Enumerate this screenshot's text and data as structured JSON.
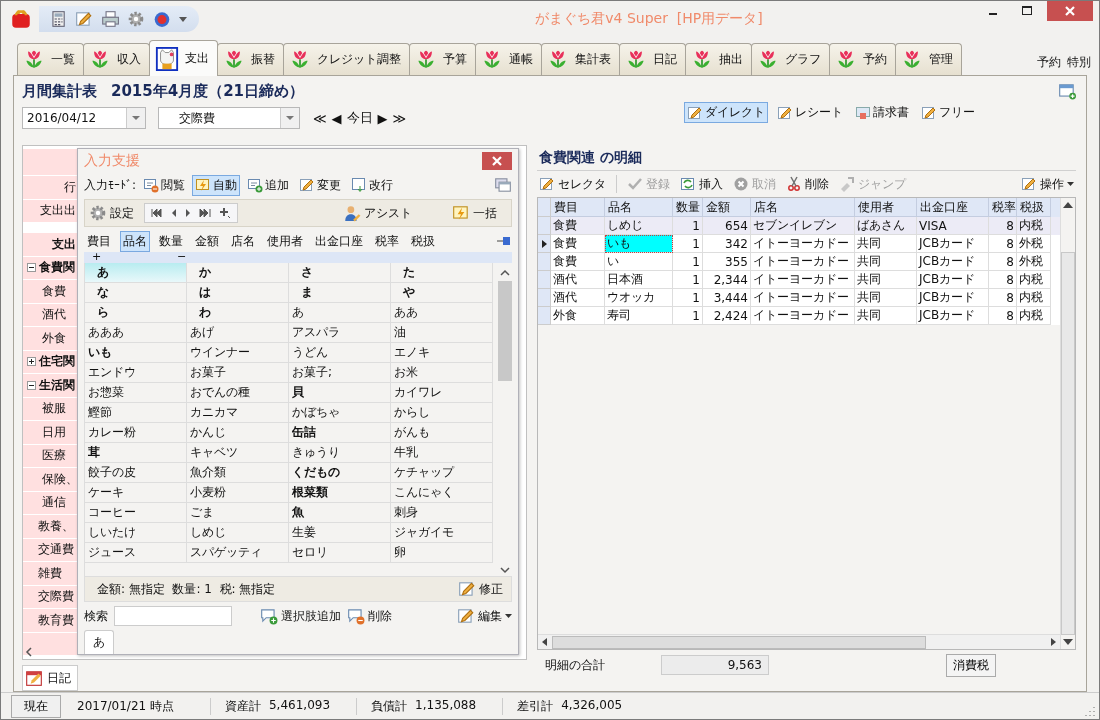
{
  "window": {
    "title": "がまぐち君v4 Super  [HP用データ]"
  },
  "tabs": [
    {
      "label": "一覧",
      "selected": false
    },
    {
      "label": "収入",
      "selected": false
    },
    {
      "label": "支出",
      "selected": true
    },
    {
      "label": "振替",
      "selected": false
    },
    {
      "label": "クレジット調整",
      "selected": false
    },
    {
      "label": "予算",
      "selected": false
    },
    {
      "label": "通帳",
      "selected": false
    },
    {
      "label": "集計表",
      "selected": false
    },
    {
      "label": "日記",
      "selected": false
    },
    {
      "label": "抽出",
      "selected": false
    },
    {
      "label": "グラフ",
      "selected": false
    },
    {
      "label": "予約",
      "selected": false
    },
    {
      "label": "管理",
      "selected": false
    }
  ],
  "tab_links": [
    "予約",
    "特別"
  ],
  "header": {
    "title": "月間集計表",
    "period": "2015年4月度（21日締め）",
    "date": "2016/04/12",
    "category": "交際費",
    "nav": [
      "≪",
      "◀",
      "今日",
      "▶",
      "≫"
    ]
  },
  "views": [
    {
      "label": "ダイレクト",
      "selected": true
    },
    {
      "label": "レシート",
      "selected": false
    },
    {
      "label": "請求書",
      "selected": false
    },
    {
      "label": "フリー",
      "selected": false
    }
  ],
  "sheet": {
    "top_rows": [
      "行",
      "支出出"
    ],
    "tree_header": "支出",
    "tree": [
      {
        "label": "食費関",
        "expanded": true,
        "children": [
          {
            "label": "食費"
          },
          {
            "label": "酒代"
          },
          {
            "label": "外食"
          }
        ]
      },
      {
        "label": "住宅関",
        "expanded": false
      },
      {
        "label": "生活関",
        "expanded": true,
        "children": [
          {
            "label": "被服"
          },
          {
            "label": "日用"
          },
          {
            "label": "医療"
          },
          {
            "label": "保険、"
          },
          {
            "label": "通信"
          }
        ]
      },
      {
        "label": "教養、"
      },
      {
        "label": "交通費"
      },
      {
        "label": "雑費"
      },
      {
        "label": "交際費"
      },
      {
        "label": "教育費"
      }
    ]
  },
  "assist": {
    "title": "入力支援",
    "mode_label": "入力ﾓｰﾄﾞ:",
    "modes": [
      {
        "label": "閲覧",
        "selected": false
      },
      {
        "label": "自動",
        "selected": true
      },
      {
        "label": "追加",
        "selected": false
      },
      {
        "label": "変更",
        "selected": false
      },
      {
        "label": "改行",
        "selected": false
      }
    ],
    "settings": "設定",
    "assist_button": "アシスト",
    "bulk_button": "一括",
    "fields": [
      {
        "label": "費目",
        "selected": false
      },
      {
        "label": "品名",
        "selected": true
      },
      {
        "label": "数量",
        "selected": false
      },
      {
        "label": "金額",
        "selected": false
      },
      {
        "label": "店名",
        "selected": false
      },
      {
        "label": "使用者",
        "selected": false
      },
      {
        "label": "出金口座",
        "selected": false
      },
      {
        "label": "税率",
        "selected": false
      },
      {
        "label": "税扱",
        "selected": false
      }
    ],
    "expand": "+",
    "collapse": "−",
    "grid": [
      [
        {
          "text": "あ",
          "kind": "kana",
          "selected": true
        },
        {
          "text": "か",
          "kind": "kana",
          "selected": false
        },
        {
          "text": "さ",
          "kind": "kana",
          "selected": false
        },
        {
          "text": "た",
          "kind": "kana",
          "selected": false
        }
      ],
      [
        {
          "text": "な",
          "kind": "kana",
          "selected": false
        },
        {
          "text": "は",
          "kind": "kana",
          "selected": false
        },
        {
          "text": "ま",
          "kind": "kana",
          "selected": false
        },
        {
          "text": "や",
          "kind": "kana",
          "selected": false
        }
      ],
      [
        {
          "text": "ら",
          "kind": "kana",
          "selected": false
        },
        {
          "text": "わ",
          "kind": "kana",
          "selected": false
        },
        {
          "text": "あ",
          "kind": "item",
          "selected": false
        },
        {
          "text": "ああ",
          "kind": "item",
          "selected": false
        }
      ],
      [
        {
          "text": "あああ",
          "kind": "item",
          "selected": false
        },
        {
          "text": "あげ",
          "kind": "item",
          "selected": false
        },
        {
          "text": "アスパラ",
          "kind": "item",
          "selected": false
        },
        {
          "text": "油",
          "kind": "item",
          "selected": false
        }
      ],
      [
        {
          "text": "いも",
          "kind": "group",
          "selected": false
        },
        {
          "text": "ウインナー",
          "kind": "item",
          "selected": false
        },
        {
          "text": "うどん",
          "kind": "item",
          "selected": false
        },
        {
          "text": "エノキ",
          "kind": "item",
          "selected": false
        }
      ],
      [
        {
          "text": "エンドウ",
          "kind": "item",
          "selected": false
        },
        {
          "text": "お菓子",
          "kind": "item",
          "selected": false
        },
        {
          "text": "お菓子;",
          "kind": "item",
          "selected": false
        },
        {
          "text": "お米",
          "kind": "item",
          "selected": false
        }
      ],
      [
        {
          "text": "お惣菜",
          "kind": "item",
          "selected": false
        },
        {
          "text": "おでんの種",
          "kind": "item",
          "selected": false
        },
        {
          "text": "貝",
          "kind": "group",
          "selected": false
        },
        {
          "text": "カイワレ",
          "kind": "item",
          "selected": false
        }
      ],
      [
        {
          "text": "鰹節",
          "kind": "item",
          "selected": false
        },
        {
          "text": "カニカマ",
          "kind": "item",
          "selected": false
        },
        {
          "text": "かぼちゃ",
          "kind": "item",
          "selected": false
        },
        {
          "text": "からし",
          "kind": "item",
          "selected": false
        }
      ],
      [
        {
          "text": "カレー粉",
          "kind": "item",
          "selected": false
        },
        {
          "text": "かんじ",
          "kind": "item",
          "selected": false
        },
        {
          "text": "缶詰",
          "kind": "group",
          "selected": false
        },
        {
          "text": "がんも",
          "kind": "item",
          "selected": false
        }
      ],
      [
        {
          "text": "茸",
          "kind": "group",
          "selected": false
        },
        {
          "text": "キャベツ",
          "kind": "item",
          "selected": false
        },
        {
          "text": "きゅうり",
          "kind": "item",
          "selected": false
        },
        {
          "text": "牛乳",
          "kind": "item",
          "selected": false
        }
      ],
      [
        {
          "text": "餃子の皮",
          "kind": "item",
          "selected": false
        },
        {
          "text": "魚介類",
          "kind": "item",
          "selected": false
        },
        {
          "text": "くだもの",
          "kind": "group",
          "selected": false
        },
        {
          "text": "ケチャップ",
          "kind": "item",
          "selected": false
        }
      ],
      [
        {
          "text": "ケーキ",
          "kind": "item",
          "selected": false
        },
        {
          "text": "小麦粉",
          "kind": "item",
          "selected": false
        },
        {
          "text": "根菜類",
          "kind": "group",
          "selected": false
        },
        {
          "text": "こんにゃく",
          "kind": "item",
          "selected": false
        }
      ],
      [
        {
          "text": "コーヒー",
          "kind": "item",
          "selected": false
        },
        {
          "text": "ごま",
          "kind": "item",
          "selected": false
        },
        {
          "text": "魚",
          "kind": "group",
          "selected": false
        },
        {
          "text": "刺身",
          "kind": "item",
          "selected": false
        }
      ],
      [
        {
          "text": "しいたけ",
          "kind": "item",
          "selected": false
        },
        {
          "text": "しめじ",
          "kind": "item",
          "selected": false
        },
        {
          "text": "生姜",
          "kind": "item",
          "selected": false
        },
        {
          "text": "ジャガイモ",
          "kind": "item",
          "selected": false
        }
      ],
      [
        {
          "text": "ジュース",
          "kind": "item",
          "selected": false
        },
        {
          "text": "スパゲッティ",
          "kind": "item",
          "selected": false
        },
        {
          "text": "セロリ",
          "kind": "item",
          "selected": false
        },
        {
          "text": "卵",
          "kind": "item",
          "selected": false
        }
      ]
    ],
    "summary": "金額: 無指定  数量: 1  税: 無指定",
    "fix_button": "修正",
    "search_label": "検索",
    "add_choice": "選択肢追加",
    "delete": "削除",
    "edit_menu": "編集",
    "page_tab": "あ"
  },
  "diary_tab": "日記",
  "detail": {
    "title": "食費関連 の明細",
    "toolbar": [
      {
        "label": "セレクタ",
        "disabled": false
      },
      {
        "label": "登録",
        "disabled": true
      },
      {
        "label": "挿入",
        "disabled": false
      },
      {
        "label": "取消",
        "disabled": true
      },
      {
        "label": "削除",
        "disabled": false
      },
      {
        "label": "ジャンプ",
        "disabled": true
      }
    ],
    "menu": "操作",
    "columns": [
      "費目",
      "品名",
      "数量",
      "金額",
      "店名",
      "使用者",
      "出金口座",
      "税率",
      "税扱"
    ],
    "rows": [
      {
        "current": false,
        "highlighted": true,
        "cells": [
          {
            "text": "食費",
            "selected": false
          },
          {
            "text": "しめじ",
            "selected": false
          },
          {
            "text": "1",
            "selected": false
          },
          {
            "text": "654",
            "selected": false
          },
          {
            "text": "セブンイレブン",
            "selected": false
          },
          {
            "text": "ばあさん",
            "selected": false
          },
          {
            "text": "VISA",
            "selected": false
          },
          {
            "text": "8",
            "selected": false
          },
          {
            "text": "内税",
            "selected": false
          }
        ]
      },
      {
        "current": true,
        "highlighted": false,
        "cells": [
          {
            "text": "食費",
            "selected": false
          },
          {
            "text": "いも",
            "selected": true
          },
          {
            "text": "1",
            "selected": false
          },
          {
            "text": "342",
            "selected": false
          },
          {
            "text": "イトーヨーカドー",
            "selected": false
          },
          {
            "text": "共同",
            "selected": false
          },
          {
            "text": "JCBカード",
            "selected": false
          },
          {
            "text": "8",
            "selected": false
          },
          {
            "text": "外税",
            "selected": false
          }
        ]
      },
      {
        "current": false,
        "highlighted": false,
        "cells": [
          {
            "text": "食費",
            "selected": false
          },
          {
            "text": "い",
            "selected": false
          },
          {
            "text": "1",
            "selected": false
          },
          {
            "text": "355",
            "selected": false
          },
          {
            "text": "イトーヨーカドー",
            "selected": false
          },
          {
            "text": "共同",
            "selected": false
          },
          {
            "text": "JCBカード",
            "selected": false
          },
          {
            "text": "8",
            "selected": false
          },
          {
            "text": "外税",
            "selected": false
          }
        ]
      },
      {
        "current": false,
        "highlighted": false,
        "cells": [
          {
            "text": "酒代",
            "selected": false
          },
          {
            "text": "日本酒",
            "selected": false
          },
          {
            "text": "1",
            "selected": false
          },
          {
            "text": "2,344",
            "selected": false
          },
          {
            "text": "イトーヨーカドー",
            "selected": false
          },
          {
            "text": "共同",
            "selected": false
          },
          {
            "text": "JCBカード",
            "selected": false
          },
          {
            "text": "8",
            "selected": false
          },
          {
            "text": "内税",
            "selected": false
          }
        ]
      },
      {
        "current": false,
        "highlighted": false,
        "cells": [
          {
            "text": "酒代",
            "selected": false
          },
          {
            "text": "ウオッカ",
            "selected": false
          },
          {
            "text": "1",
            "selected": false
          },
          {
            "text": "3,444",
            "selected": false
          },
          {
            "text": "イトーヨーカドー",
            "selected": false
          },
          {
            "text": "共同",
            "selected": false
          },
          {
            "text": "JCBカード",
            "selected": false
          },
          {
            "text": "8",
            "selected": false
          },
          {
            "text": "内税",
            "selected": false
          }
        ]
      },
      {
        "current": false,
        "highlighted": false,
        "cells": [
          {
            "text": "外食",
            "selected": false
          },
          {
            "text": "寿司",
            "selected": false
          },
          {
            "text": "1",
            "selected": false
          },
          {
            "text": "2,424",
            "selected": false
          },
          {
            "text": "イトーヨーカドー",
            "selected": false
          },
          {
            "text": "共同",
            "selected": false
          },
          {
            "text": "JCBカード",
            "selected": false
          },
          {
            "text": "8",
            "selected": false
          },
          {
            "text": "内税",
            "selected": false
          }
        ]
      }
    ],
    "total_label": "明細の合計",
    "total": "9,563",
    "tax_button": "消費税"
  },
  "status_bar": {
    "button": "現在",
    "as_of": "2017/01/21 時点",
    "items": [
      {
        "label": "資産計",
        "value": "5,461,093"
      },
      {
        "label": "負債計",
        "value": "1,135,088"
      },
      {
        "label": "差引計",
        "value": "4,326,005"
      }
    ]
  }
}
